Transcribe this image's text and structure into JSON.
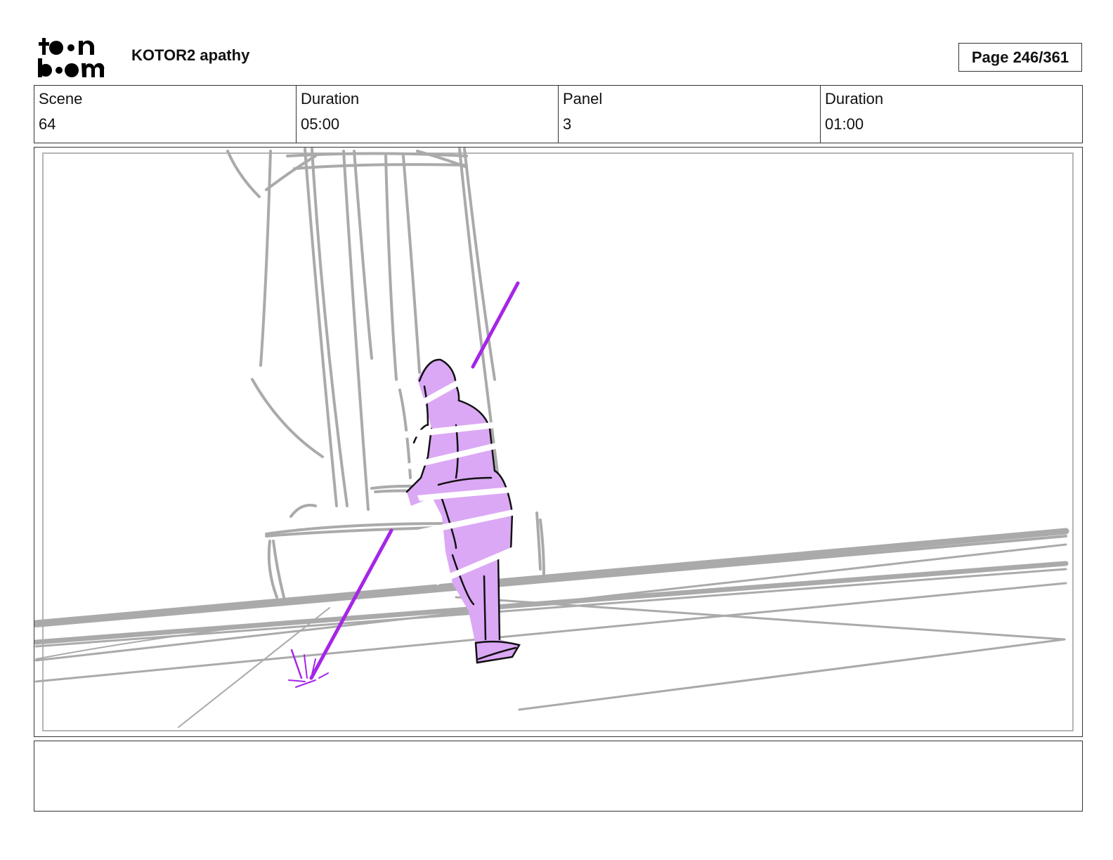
{
  "header": {
    "logo_text": "toon boom",
    "project_title": "KOTOR2 apathy",
    "page_label": "Page 246/361"
  },
  "info": {
    "scene_label": "Scene",
    "scene_value": "64",
    "scene_duration_label": "Duration",
    "scene_duration_value": "05:00",
    "panel_label": "Panel",
    "panel_value": "3",
    "panel_duration_label": "Duration",
    "panel_duration_value": "01:00"
  },
  "colors": {
    "sketch_gray": "#aaaaaa",
    "figure_fill": "#dba8f5",
    "saber": "#a526e6",
    "ink": "#111111"
  },
  "notes": {
    "text": ""
  }
}
